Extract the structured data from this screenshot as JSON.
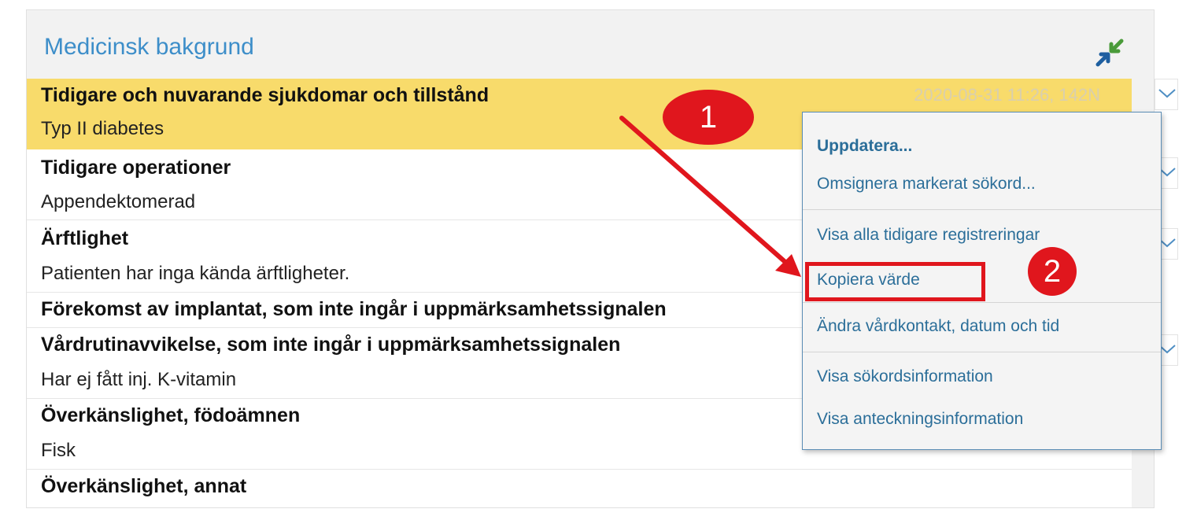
{
  "panel": {
    "title": "Medicinsk bakgrund",
    "collapse_icon": "collapse-arrows-icon"
  },
  "rows": [
    {
      "term": "Tidigare och nuvarande sjukdomar och tillstånd",
      "value": "Typ II diabetes",
      "timestamp": "2020-08-31 11:26, 142N",
      "highlighted": true
    },
    {
      "term": "Tidigare operationer",
      "value": "Appendektomerad"
    },
    {
      "term": "Ärftlighet",
      "value": "Patienten har inga kända ärftligheter."
    },
    {
      "term": "Förekomst av implantat, som inte ingår i uppmärksamhetssignalen"
    },
    {
      "term": "Vårdrutinavvikelse, som inte ingår i uppmärksamhetssignalen",
      "value": "Har ej fått inj. K-vitamin"
    },
    {
      "term": "Överkänslighet, födoämnen",
      "value": "Fisk"
    },
    {
      "term": "Överkänslighet, annat"
    }
  ],
  "context_menu": {
    "items": [
      "Uppdatera...",
      "Omsignera markerat sökord...",
      "Visa alla tidigare registreringar",
      "Kopiera värde",
      "Ändra vårdkontakt, datum och tid",
      "Visa sökordsinformation",
      "Visa anteckningsinformation"
    ]
  },
  "annotations": {
    "badge_1": "1",
    "badge_2": "2"
  },
  "colors": {
    "title": "#3d8ec9",
    "highlight_row": "#f8db6b",
    "menu_text": "#2b6e99",
    "annotation_red": "#e0161d"
  }
}
